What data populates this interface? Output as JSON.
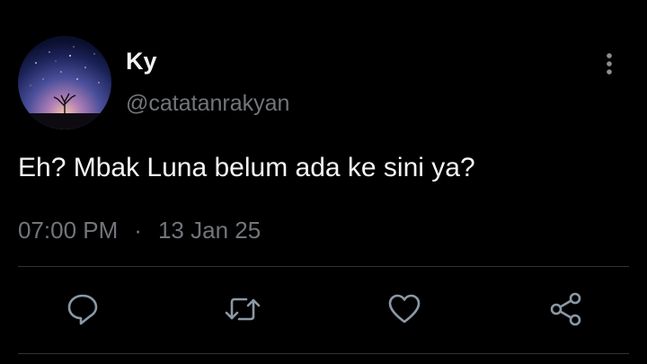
{
  "tweet": {
    "display_name": "Ky",
    "handle": "@catatanrakyan",
    "text": "Eh? Mbak Luna belum ada ke sini ya?",
    "time": "07:00 PM",
    "separator": "·",
    "date": "13 Jan 25"
  },
  "icons": {
    "more": "more-vertical-icon",
    "reply": "reply-icon",
    "retweet": "retweet-icon",
    "like": "heart-icon",
    "share": "share-icon"
  },
  "colors": {
    "background": "#000000",
    "text": "#e7e9ea",
    "secondary": "#71767b",
    "divider": "#2f3336"
  }
}
